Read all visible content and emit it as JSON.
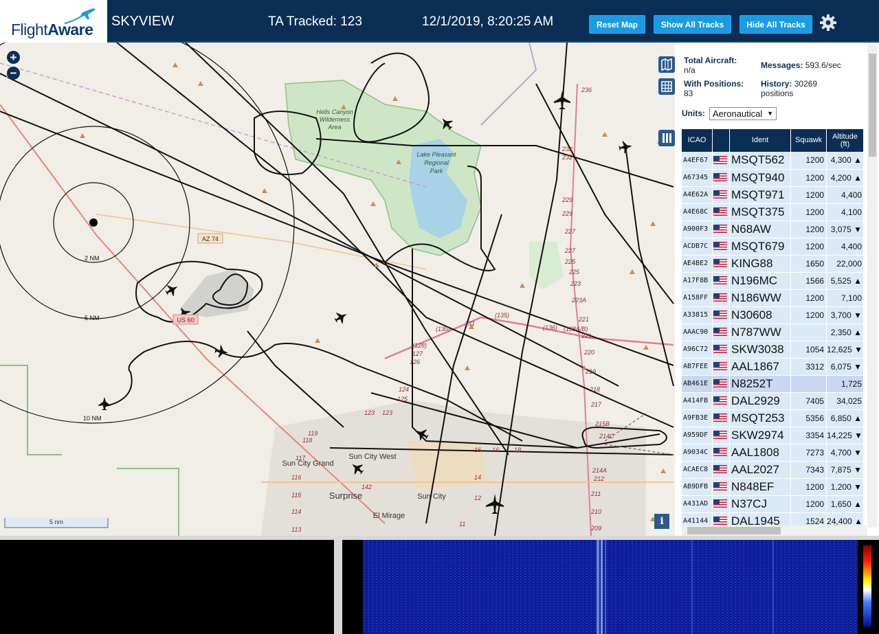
{
  "header": {
    "logo_text_a": "Flight",
    "logo_text_b": "Aware",
    "app_title": "SKYVIEW",
    "tracked": "TA Tracked: 123",
    "datetime": "12/1/2019, 8:20:25 AM",
    "buttons": [
      "Reset Map",
      "Show All Tracks",
      "Hide All Tracks"
    ]
  },
  "map": {
    "zoom_in": "+",
    "zoom_out": "−",
    "scale_label": "5 nm",
    "range_rings": [
      "2 NM",
      "5 NM",
      "10 NM"
    ],
    "place_labels": [
      "Hells Canyon Wilderness Area",
      "Lake Pleasant Regional Park",
      "Sun City Grand",
      "Sun City West",
      "Surprise",
      "Sun City",
      "El Mirage"
    ],
    "road_labels": [
      "AZ 74",
      "US 60"
    ],
    "info": "i"
  },
  "stats": {
    "total_aircraft_label": "Total Aircraft:",
    "total_aircraft": "n/a",
    "with_positions_label": "With Positions:",
    "with_positions": "83",
    "messages_label": "Messages:",
    "messages": "593.6/sec",
    "history_label": "History:",
    "history": "30269",
    "history_unit": "positions"
  },
  "units": {
    "label": "Units:",
    "value": "Aeronautical"
  },
  "table": {
    "headers": [
      "ICAO",
      "Ident",
      "Squawk",
      "Altitude (ft)"
    ],
    "rows": [
      {
        "icao": "A4EF67",
        "ident": "MSQT562",
        "squawk": "1200",
        "alt": "4,300 ▲"
      },
      {
        "icao": "A67345",
        "ident": "MSQT940",
        "squawk": "1200",
        "alt": "4,200 ▲"
      },
      {
        "icao": "A4E62A",
        "ident": "MSQT971",
        "squawk": "1200",
        "alt": "4,400"
      },
      {
        "icao": "A4E68C",
        "ident": "MSQT375",
        "squawk": "1200",
        "alt": "4,100"
      },
      {
        "icao": "A900F3",
        "ident": "N68AW",
        "squawk": "1200",
        "alt": "3,075 ▼"
      },
      {
        "icao": "ACDB7C",
        "ident": "MSQT679",
        "squawk": "1200",
        "alt": "4,400"
      },
      {
        "icao": "AE4BE2",
        "ident": "KING88",
        "squawk": "1650",
        "alt": "22,000"
      },
      {
        "icao": "A17F8B",
        "ident": "N196MC",
        "squawk": "1566",
        "alt": "5,525 ▲"
      },
      {
        "icao": "A158FF",
        "ident": "N186WW",
        "squawk": "1200",
        "alt": "7,100"
      },
      {
        "icao": "A33815",
        "ident": "N30608",
        "squawk": "1200",
        "alt": "3,700 ▼"
      },
      {
        "icao": "AAAC90",
        "ident": "N787WW",
        "squawk": "",
        "alt": "2,350 ▲"
      },
      {
        "icao": "A96C72",
        "ident": "SKW3038",
        "squawk": "1054",
        "alt": "12,625 ▼"
      },
      {
        "icao": "AB7FEE",
        "ident": "AAL1867",
        "squawk": "3312",
        "alt": "6,075 ▼"
      },
      {
        "icao": "AB461E",
        "ident": "N8252T",
        "squawk": "",
        "alt": "1,725"
      },
      {
        "icao": "A414FB",
        "ident": "DAL2929",
        "squawk": "7405",
        "alt": "34,025"
      },
      {
        "icao": "A9FB3E",
        "ident": "MSQT253",
        "squawk": "5356",
        "alt": "6,850 ▲"
      },
      {
        "icao": "A959DF",
        "ident": "SKW2974",
        "squawk": "3354",
        "alt": "14,225 ▼"
      },
      {
        "icao": "A9034C",
        "ident": "AAL1808",
        "squawk": "7273",
        "alt": "4,700 ▼"
      },
      {
        "icao": "ACAEC8",
        "ident": "AAL2027",
        "squawk": "7343",
        "alt": "7,875 ▼"
      },
      {
        "icao": "AB9DFB",
        "ident": "N848EF",
        "squawk": "1200",
        "alt": "1,200 ▼"
      },
      {
        "icao": "A431AD",
        "ident": "N37CJ",
        "squawk": "1200",
        "alt": "1,650 ▲"
      },
      {
        "icao": "A41144",
        "ident": "DAL1945",
        "squawk": "1524",
        "alt": "24,400 ▲"
      }
    ],
    "selected_index": 13
  },
  "colors": {
    "header_bg": "#0b2e55",
    "button": "#1a9be6",
    "row": "#dceaf8",
    "row_selected": "#c9d7f3"
  }
}
